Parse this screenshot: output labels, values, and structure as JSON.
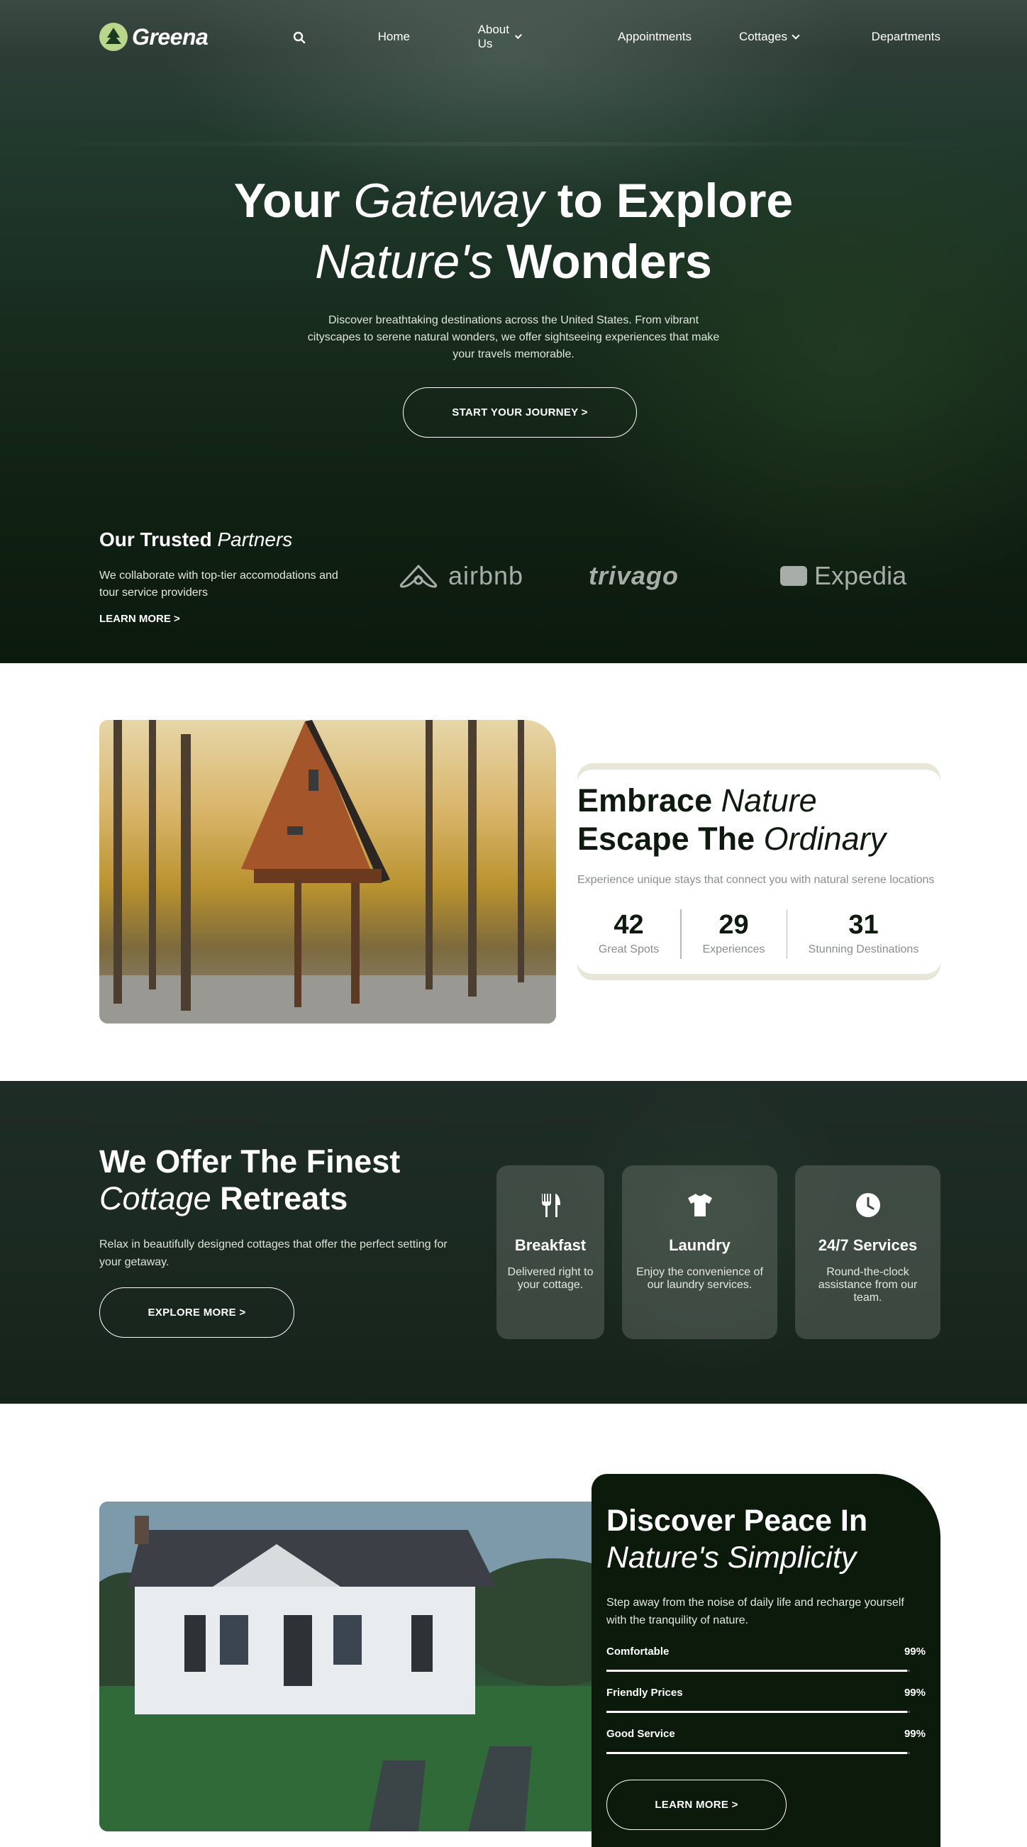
{
  "nav": {
    "logo": "Greena",
    "links": [
      {
        "label": "Home",
        "dropdown": false
      },
      {
        "label": "About Us",
        "dropdown": true
      },
      {
        "label": "Appointments",
        "dropdown": false
      },
      {
        "label": "Cottages",
        "dropdown": true
      },
      {
        "label": "Departments",
        "dropdown": false
      }
    ]
  },
  "hero": {
    "title_1": "Your ",
    "title_1_italic": "Gateway",
    "title_1_end": " to Explore",
    "title_2_italic": "Nature's",
    "title_2_end": " Wonders",
    "description": "Discover breathtaking destinations across the United States. From vibrant cityscapes to serene natural wonders, we offer sightseeing experiences that make your travels memorable.",
    "cta": "START YOUR JOURNEY >"
  },
  "partners": {
    "title": "Our Trusted ",
    "title_italic": "Partners",
    "description": "We collaborate with top-tier accomodations and tour service providers",
    "link": "LEARN MORE >",
    "logos": [
      "airbnb",
      "trivago",
      "Expedia"
    ]
  },
  "embrace": {
    "line_1": "Embrace ",
    "line_1_italic": "Nature",
    "line_2": "Escape The ",
    "line_2_italic": "Ordinary",
    "subtitle": "Experience unique stays that connect you with natural serene locations",
    "stats": [
      {
        "value": "42",
        "label": "Great Spots"
      },
      {
        "value": "29",
        "label": "Experiences"
      },
      {
        "value": "31",
        "label": "Stunning Destinations"
      }
    ]
  },
  "finest": {
    "line_1": "We Offer The Finest",
    "line_2_italic": "Cottage",
    "line_2_end": " Retreats",
    "description": "Relax in beautifully designed cottages that offer the perfect setting for your getaway.",
    "cta": "EXPLORE MORE >",
    "services": [
      {
        "icon": "utensils-icon",
        "title": "Breakfast",
        "desc": "Delivered right to your cottage."
      },
      {
        "icon": "shirt-icon",
        "title": "Laundry",
        "desc": "Enjoy the convenience of our laundry services."
      },
      {
        "icon": "clock-icon",
        "title": "24/7 Services",
        "desc": "Round-the-clock assistance from our team."
      }
    ]
  },
  "peace": {
    "line_1": "Discover Peace In",
    "line_2_italic": "Nature's Simplicity",
    "description": "Step away from the noise of daily life and recharge yourself with the tranquility of nature.",
    "bars": [
      {
        "label": "Comfortable",
        "value": "99%",
        "fraction": 0.99
      },
      {
        "label": "Friendly Prices",
        "value": "99%",
        "fraction": 0.99
      },
      {
        "label": "Good Service",
        "value": "99%",
        "fraction": 0.99
      }
    ],
    "cta": "LEARN MORE >"
  }
}
